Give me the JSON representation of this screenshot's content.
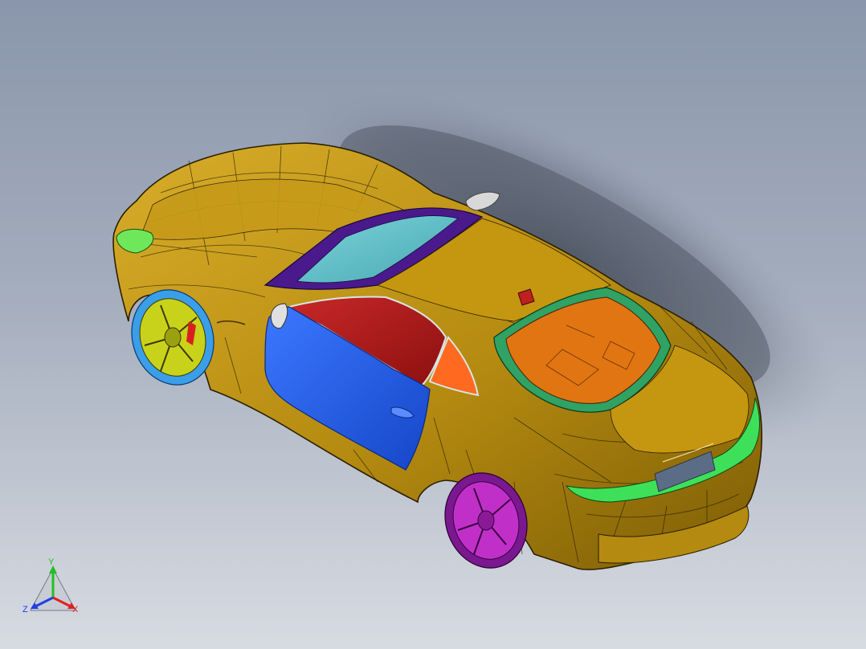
{
  "viewport": {
    "background_top": "#8a96ab",
    "background_bottom": "#d7dbe2"
  },
  "model": {
    "name": "car-model",
    "colors": {
      "body": "#b48a10",
      "body_highlight": "#d8ad2a",
      "body_shadow": "#7d5d06",
      "door": "#1f5cf0",
      "side_window": "#b01c1c",
      "quarter_window": "#ff6a20",
      "rear_window": "#e07512",
      "rear_window_frame": "#2fa264",
      "windshield": "#5fc0c8",
      "windshield_frame": "#4a1a8c",
      "headlight": "#6ee85a",
      "taillight": "#3ee05a",
      "front_wheel": "#c9d21a",
      "front_tire": "#3a9ee8",
      "rear_wheel": "#c030c8",
      "brake_caliper": "#d82020",
      "mirror": "#d8d8d8"
    }
  },
  "triad": {
    "x_label": "X",
    "y_label": "Y",
    "z_label": "Z",
    "x_color": "#e02020",
    "y_color": "#20c020",
    "z_color": "#2040e0"
  }
}
